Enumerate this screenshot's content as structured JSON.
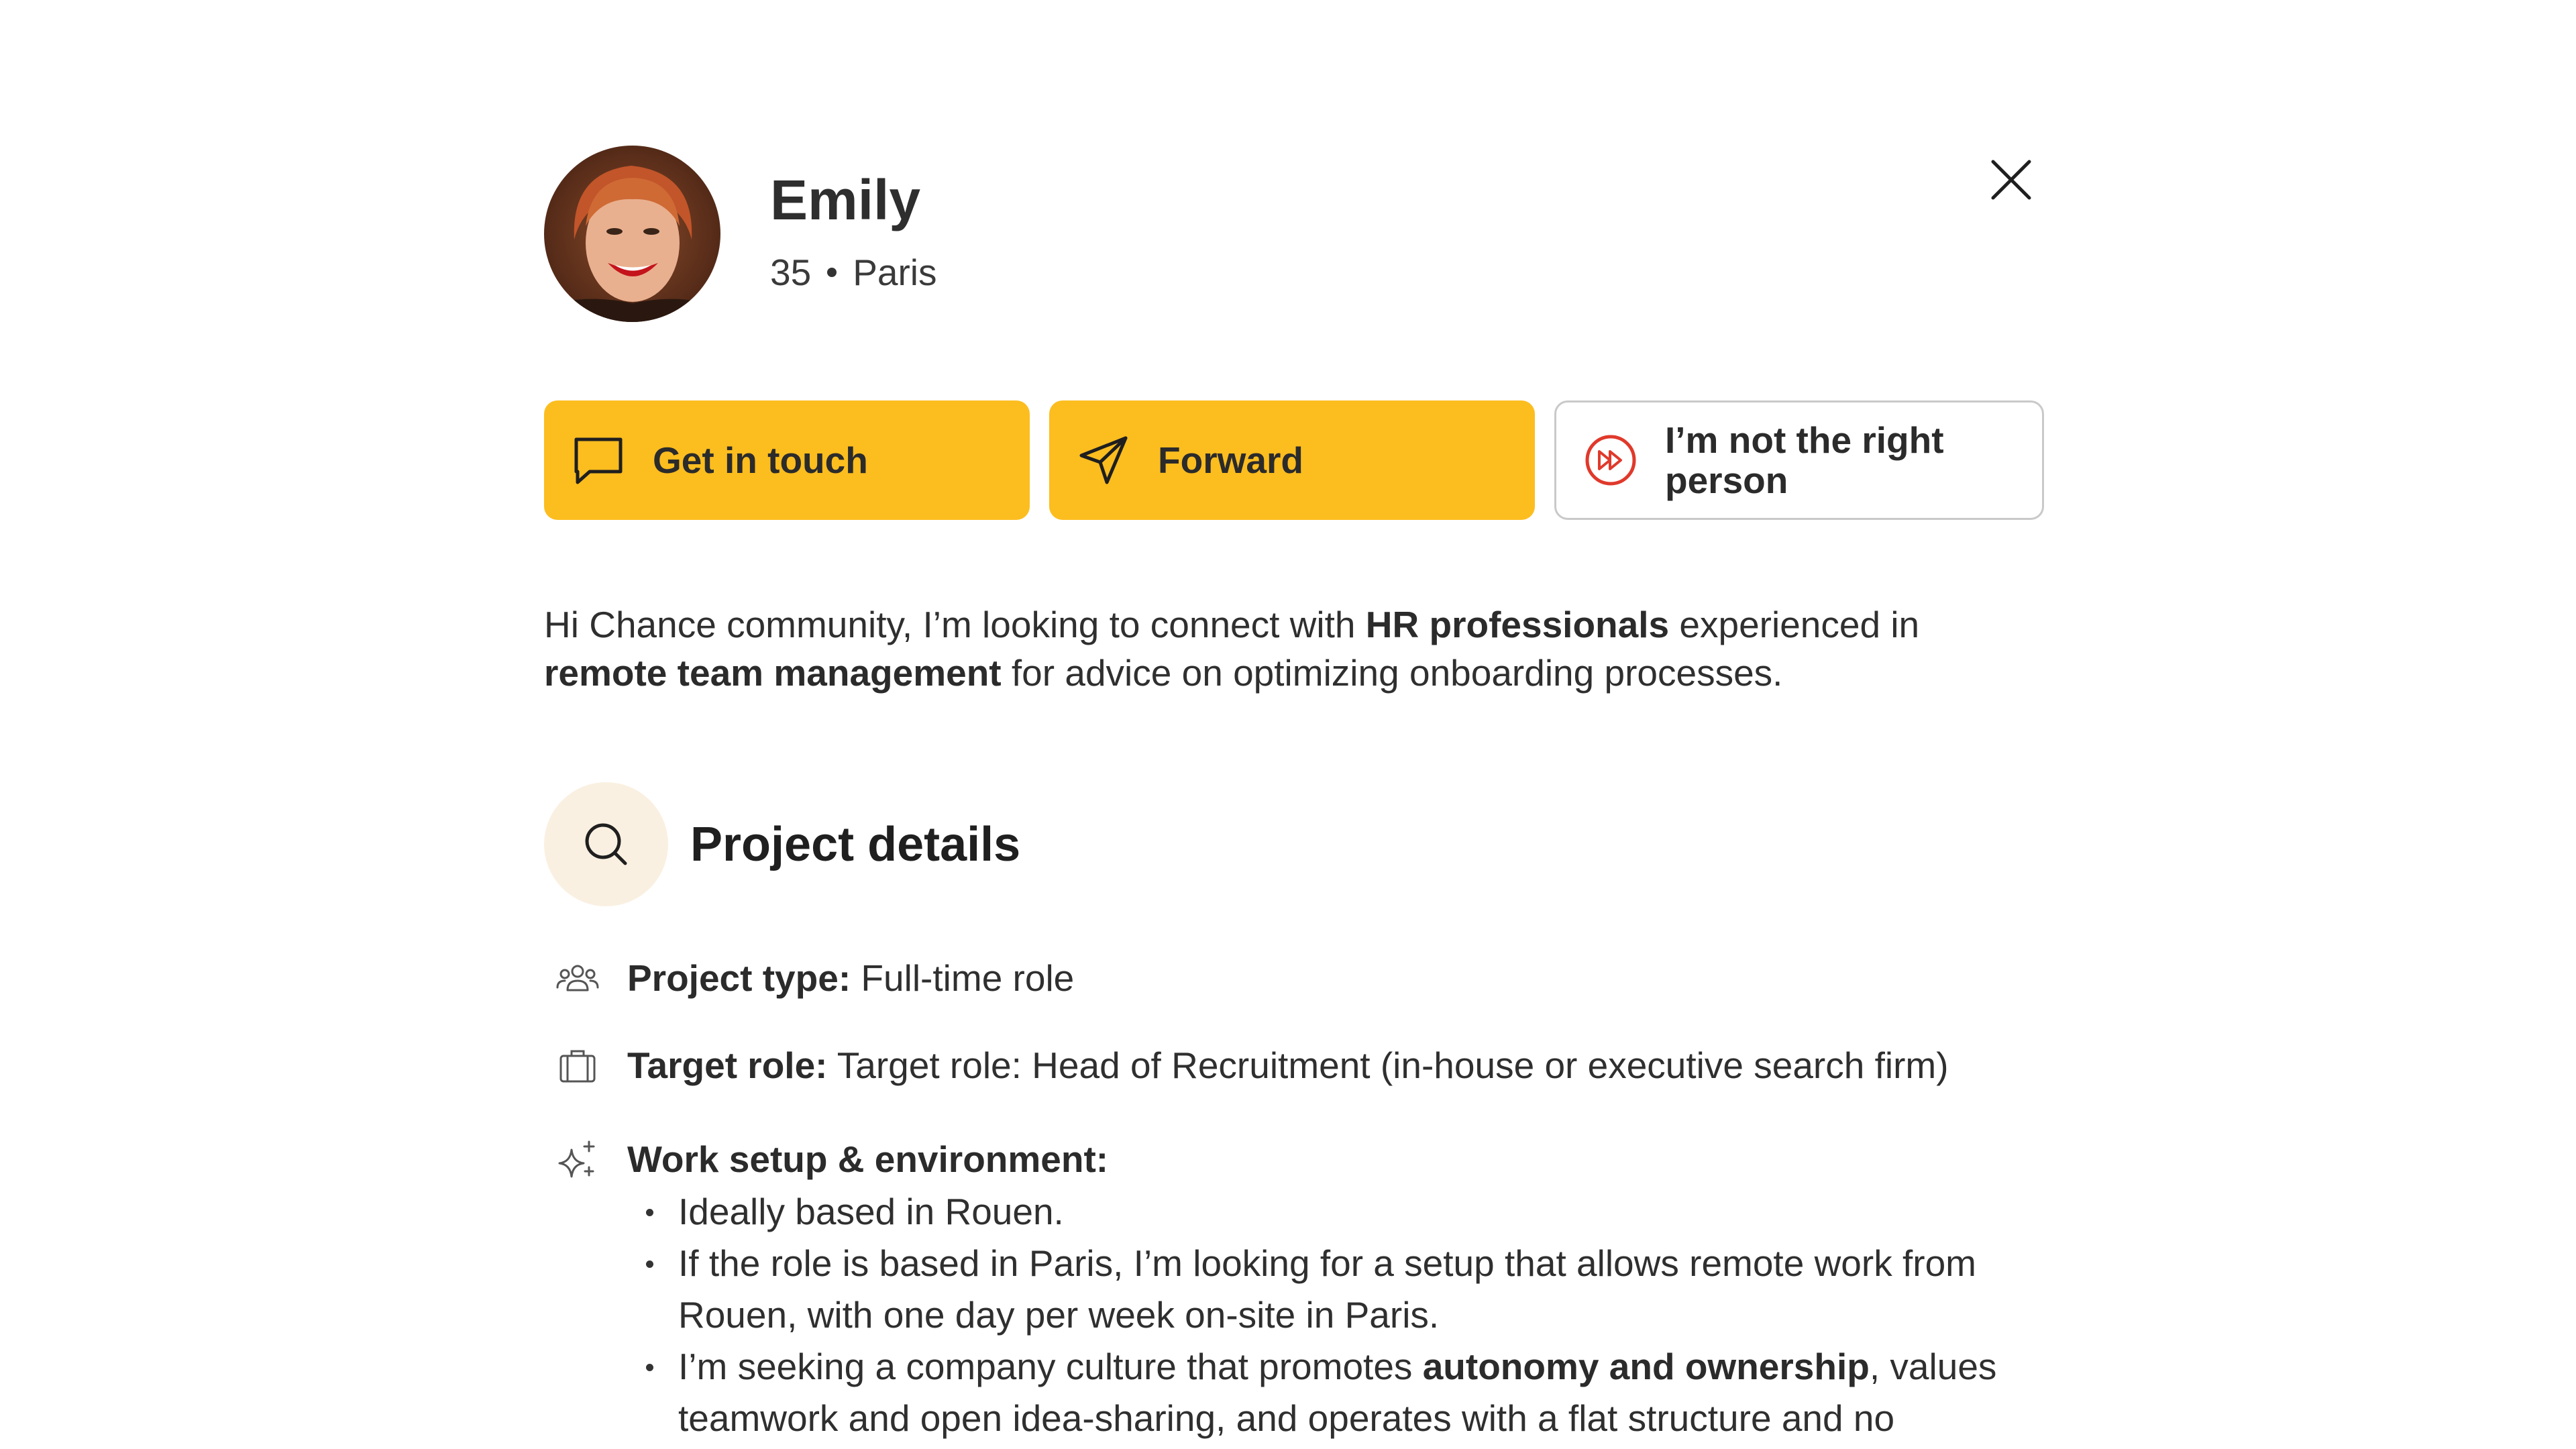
{
  "profile": {
    "name": "Emily",
    "age": "35",
    "city": "Paris",
    "avatar_icon": "user-photo"
  },
  "close_icon": "close-icon",
  "actions": {
    "get_in_touch": {
      "label": "Get in touch",
      "icon": "chat-bubble-icon"
    },
    "forward": {
      "label": "Forward",
      "icon": "paper-plane-icon"
    },
    "not_right_person": {
      "label": "I’m not the right person",
      "icon": "fast-forward-circle-icon"
    }
  },
  "intro": {
    "part1": "Hi Chance community, I’m looking to connect with ",
    "bold1": "HR professionals",
    "part2": " experienced in ",
    "bold2": "remote team management",
    "part3": " for advice on optimizing onboarding processes."
  },
  "section": {
    "title": "Project details",
    "icon": "search-icon"
  },
  "details": {
    "project_type": {
      "label": "Project type:",
      "value": " Full-time role",
      "icon": "people-icon"
    },
    "target_role": {
      "label": "Target role:",
      "value": " Target role: Head of Recruitment (in-house or executive search firm)",
      "icon": "briefcase-icon"
    },
    "work_setup": {
      "label": "Work setup & environment:",
      "icon": "sparkles-icon",
      "bullets": [
        {
          "text": "Ideally based in Rouen."
        },
        {
          "text": "If the role is based in Paris, I’m looking for a setup that allows remote work from Rouen, with one day per week on-site in Paris."
        },
        {
          "pre": "I’m seeking a company culture that promotes ",
          "bold": "autonomy and ownership",
          "post": ", values teamwork and open idea-sharing, and operates with a flat structure and no"
        }
      ]
    }
  },
  "colors": {
    "primary_button": "#FCBD1F",
    "section_icon_bg": "#FAF0E1",
    "not_right_icon": "#E0392B"
  }
}
